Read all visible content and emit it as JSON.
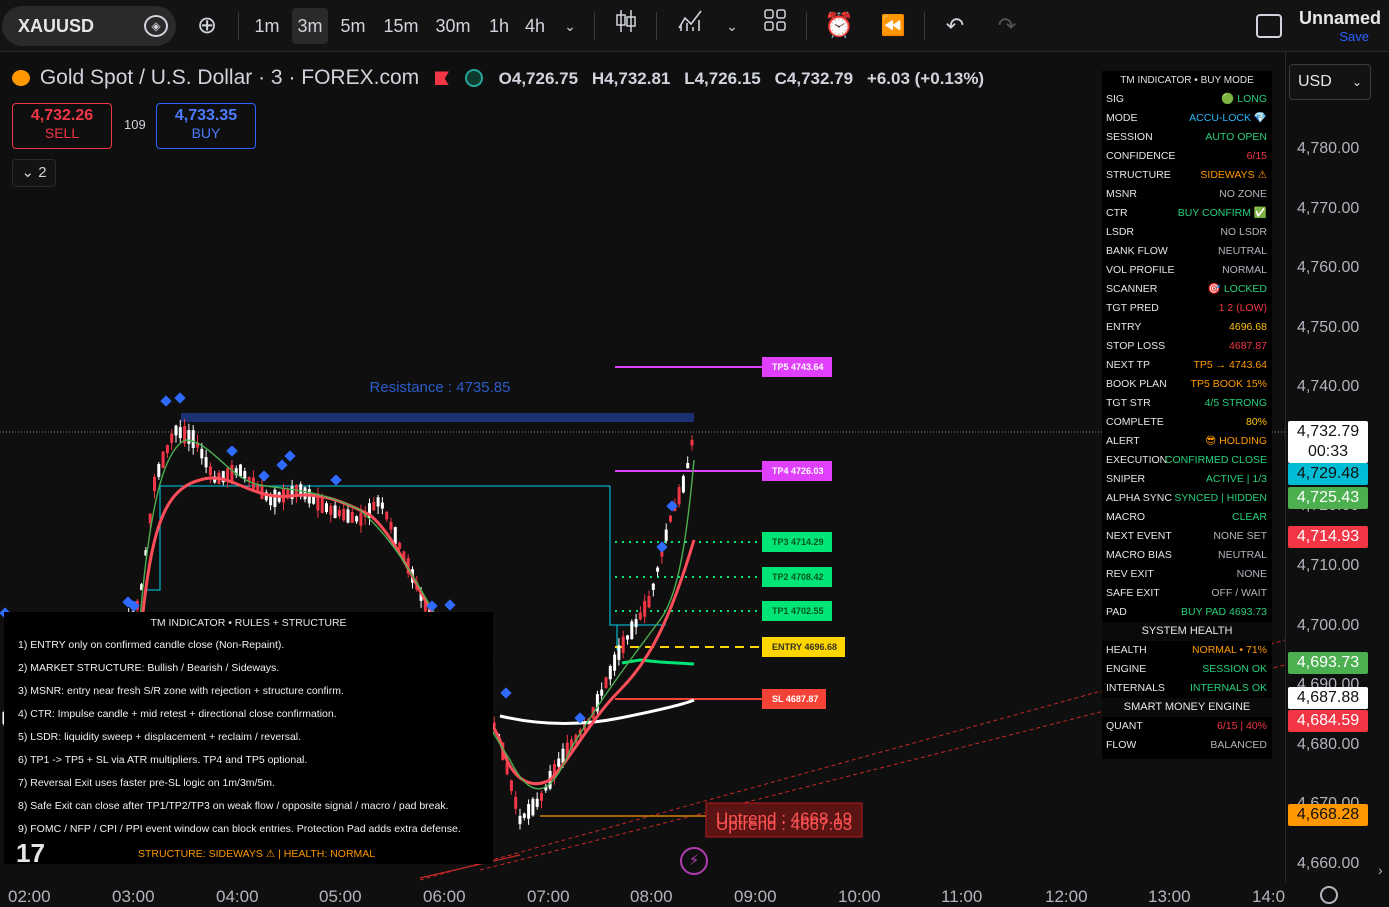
{
  "toolbar": {
    "symbol": "XAUUSD",
    "intervals": [
      "1m",
      "3m",
      "5m",
      "15m",
      "30m",
      "1h",
      "4h"
    ],
    "active_interval": "3m",
    "layout_name": "Unnamed",
    "save_label": "Save"
  },
  "legend": {
    "title": "Gold Spot / U.S. Dollar · 3 · FOREX.com",
    "open": "O4,726.75",
    "high": "H4,732.81",
    "low": "L4,726.15",
    "close": "C4,732.79",
    "change": "+6.03 (+0.13%)"
  },
  "trade": {
    "sell_price": "4,732.26",
    "sell_label": "SELL",
    "spread": "109",
    "buy_price": "4,733.35",
    "buy_label": "BUY",
    "collapse_count": "2"
  },
  "price_axis": {
    "currency": "USD",
    "ticks": [
      "4,780.00",
      "4,770.00",
      "4,760.00",
      "4,750.00",
      "4,740.00",
      "4,720.00",
      "4,710.00",
      "4,700.00",
      "4,690.00",
      "4,680.00",
      "4,670.00",
      "4,660.00"
    ],
    "current_price": "4,732.79",
    "countdown": "00:33",
    "tags": [
      {
        "value": "4,729.48",
        "color": "#00bcd4"
      },
      {
        "value": "4,725.43",
        "color": "#4caf50"
      },
      {
        "value": "4,714.93",
        "color": "#f23645"
      },
      {
        "value": "4,693.73",
        "color": "#4caf50"
      },
      {
        "value": "4,687.88",
        "color": "#ffffff"
      },
      {
        "value": "4,684.59",
        "color": "#f23645"
      },
      {
        "value": "4,668.28",
        "color": "#ff9800"
      }
    ]
  },
  "time_axis": [
    "02:00",
    "03:00",
    "04:00",
    "05:00",
    "06:00",
    "07:00",
    "08:00",
    "09:00",
    "10:00",
    "11:00",
    "12:00",
    "13:00",
    "14:0"
  ],
  "chart_labels": {
    "resistance": "Resistance : 4735.85",
    "tp5": "TP5 4743.64",
    "tp4": "TP4 4726.03",
    "tp3": "TP3 4714.29",
    "tp2": "TP2 4708.42",
    "tp1": "TP1 4702.55",
    "entry": "ENTRY 4696.68",
    "sl": "SL 4687.87",
    "uptrend_1": "Uptrend : 4668.19",
    "uptrend_2": "Uptrend : 4667.03"
  },
  "panel": {
    "title": "TM INDICATOR • BUY MODE",
    "rows": [
      {
        "k": "SIG",
        "v": "🟢 LONG",
        "c": "#26d07c"
      },
      {
        "k": "MODE",
        "v": "ACCU-LOCK 💎",
        "c": "#29b6f6"
      },
      {
        "k": "SESSION",
        "v": "AUTO OPEN",
        "c": "#26d07c"
      },
      {
        "k": "CONFIDENCE",
        "v": "6/15",
        "c": "#f23645"
      },
      {
        "k": "STRUCTURE",
        "v": "SIDEWAYS ⚠",
        "c": "#ff9800"
      },
      {
        "k": "MSNR",
        "v": "NO ZONE",
        "c": "#b2b5be"
      },
      {
        "k": "CTR",
        "v": "BUY CONFIRM ✅",
        "c": "#26d07c"
      },
      {
        "k": "LSDR",
        "v": "NO LSDR",
        "c": "#b2b5be"
      },
      {
        "k": "BANK FLOW",
        "v": "NEUTRAL",
        "c": "#b2b5be"
      },
      {
        "k": "VOL PROFILE",
        "v": "NORMAL",
        "c": "#b2b5be"
      },
      {
        "k": "SCANNER",
        "v": "🎯 LOCKED",
        "c": "#26d07c"
      },
      {
        "k": "TGT PRED",
        "v": "1 2 (LOW)",
        "c": "#f23645"
      },
      {
        "k": "ENTRY",
        "v": "4696.68",
        "c": "#ffc107"
      },
      {
        "k": "STOP LOSS",
        "v": "4687.87",
        "c": "#f23645"
      },
      {
        "k": "NEXT TP",
        "v": "TP5 → 4743.64",
        "c": "#ff9800"
      },
      {
        "k": "BOOK PLAN",
        "v": "TP5 BOOK 15%",
        "c": "#ff9800"
      },
      {
        "k": "TGT STR",
        "v": "4/5 STRONG",
        "c": "#26d07c"
      },
      {
        "k": "COMPLETE",
        "v": "80%",
        "c": "#ffc107"
      },
      {
        "k": "ALERT",
        "v": "😎 HOLDING",
        "c": "#ff9800"
      },
      {
        "k": "EXECUTION",
        "v": "CONFIRMED CLOSE",
        "c": "#26d07c"
      },
      {
        "k": "SNIPER",
        "v": "ACTIVE | 1/3",
        "c": "#26d07c"
      },
      {
        "k": "ALPHA SYNC",
        "v": "SYNCED | HIDDEN",
        "c": "#26d07c"
      },
      {
        "k": "MACRO",
        "v": "CLEAR",
        "c": "#26d07c"
      },
      {
        "k": "NEXT EVENT",
        "v": "NONE SET",
        "c": "#b2b5be"
      },
      {
        "k": "MACRO BIAS",
        "v": "NEUTRAL",
        "c": "#b2b5be"
      },
      {
        "k": "REV EXIT",
        "v": "NONE",
        "c": "#b2b5be"
      },
      {
        "k": "SAFE EXIT",
        "v": "OFF / WAIT",
        "c": "#b2b5be"
      },
      {
        "k": "PAD",
        "v": "BUY PAD 4693.73",
        "c": "#26d07c"
      }
    ],
    "system_health_title": "SYSTEM HEALTH",
    "health_rows": [
      {
        "k": "HEALTH",
        "v": "NORMAL • 71%",
        "c": "#ff9800"
      },
      {
        "k": "ENGINE",
        "v": "SESSION OK",
        "c": "#26d07c"
      },
      {
        "k": "INTERNALS",
        "v": "INTERNALS OK",
        "c": "#26d07c"
      }
    ],
    "smart_money_title": "SMART MONEY ENGINE",
    "sm_rows": [
      {
        "k": "QUANT",
        "v": "6/15 | 40%",
        "c": "#f23645"
      },
      {
        "k": "FLOW",
        "v": "BALANCED",
        "c": "#b2b5be"
      }
    ]
  },
  "rules": {
    "title": "TM INDICATOR • RULES + STRUCTURE",
    "lines": [
      "1) ENTRY only on confirmed candle close (Non-Repaint).",
      "2) MARKET STRUCTURE: Bullish / Bearish / Sideways.",
      "3) MSNR: entry near fresh S/R zone with rejection + structure confirm.",
      "4) CTR: Impulse candle + mid retest + directional close confirmation.",
      "5) LSDR: liquidity sweep + displacement + reclaim / reversal.",
      "6) TP1 -> TP5 + SL via ATR multipliers. TP4 and TP5 optional.",
      "7) Reversal Exit uses faster pre-SL logic on 1m/3m/5m.",
      "8) Safe Exit can close after TP1/TP2/TP3 on weak flow / opposite signal / macro / pad break.",
      "9) FOMC / NFP / CPI / PPI event window can block entries. Protection Pad adds extra defense."
    ],
    "footer": "STRUCTURE: SIDEWAYS ⚠ | HEALTH: NORMAL"
  },
  "chart_data": {
    "type": "candlestick",
    "x": [
      "02:00",
      "03:00",
      "04:00",
      "05:00",
      "06:00",
      "07:00",
      "08:00"
    ],
    "ohlc_last": {
      "open": 4726.75,
      "high": 4732.81,
      "low": 4726.15,
      "close": 4732.79
    },
    "ylim": [
      4655,
      4790
    ]
  }
}
